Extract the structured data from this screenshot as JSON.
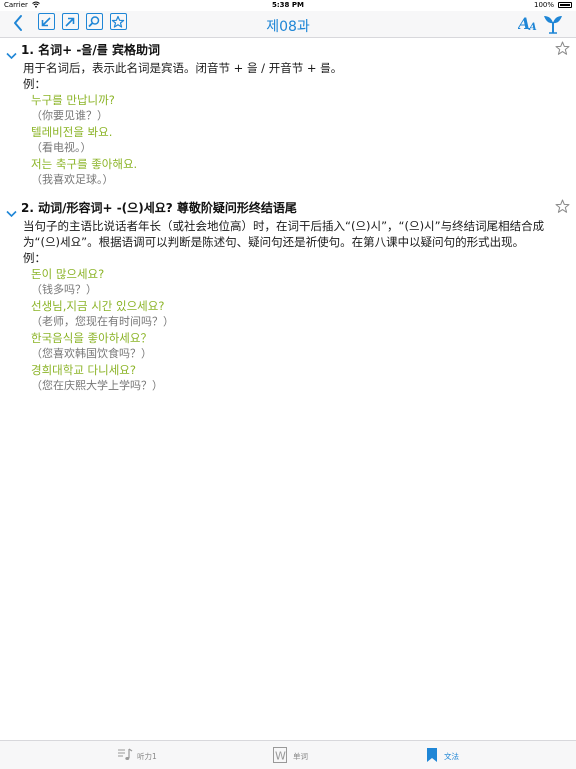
{
  "status_bar": {
    "carrier": "Carrier",
    "time": "5:38 PM",
    "battery": "100%"
  },
  "nav": {
    "title": "제08과",
    "icons": [
      "back-chevron-icon",
      "minimize-icon",
      "expand-icon",
      "search-icon",
      "favorite-star-icon",
      "font-size-icon",
      "plant-icon"
    ],
    "accent_color": "#1f86d6"
  },
  "sections": [
    {
      "title": "1.  名词+ -을/를     宾格助词",
      "description": "用于名词后，表示此名词是宾语。闭音节 + 을 / 开音节 + 를。",
      "example_label": "例：",
      "examples": [
        {
          "ko": "누구를 만납니까?",
          "zh": "（你要见谁？）"
        },
        {
          "ko": "텔레비전을 봐요.",
          "zh": "（看电视。）"
        },
        {
          "ko": "저는 축구를 좋아해요.",
          "zh": "（我喜欢足球。）"
        }
      ]
    },
    {
      "title": "2.  动词/形容词+ -(으)세요?     尊敬阶疑问形终结语尾",
      "description": "当句子的主语比说话者年长（或社会地位高）时，在词干后插入“(으)시”，“(으)시”与终结词尾相结合成为“(으)세요”。根据语调可以判断是陈述句、疑问句还是祈使句。在第八课中以疑问句的形式出现。",
      "example_label": "例：",
      "examples": [
        {
          "ko": "돈이 많으세요?",
          "zh": "（钱多吗？）"
        },
        {
          "ko": "선생님,지금 시간 있으세요?",
          "zh": "（老师，您现在有时间吗？）"
        },
        {
          "ko": "한국음식을 좋아하세요？",
          "zh": "（您喜欢韩国饮食吗？）"
        },
        {
          "ko": "경희대학교 다니세요?",
          "zh": "（您在庆熙大学上学吗？）"
        }
      ]
    }
  ],
  "tabs": [
    {
      "label": "听力1",
      "icon": "music-note-icon",
      "active": false
    },
    {
      "label": "单词",
      "icon": "word-w-icon",
      "active": false
    },
    {
      "label": "文法",
      "icon": "bookmark-icon",
      "active": true
    }
  ],
  "colors": {
    "accent": "#1f86d6",
    "korean_example": "#8cb428",
    "translation": "#777777"
  }
}
